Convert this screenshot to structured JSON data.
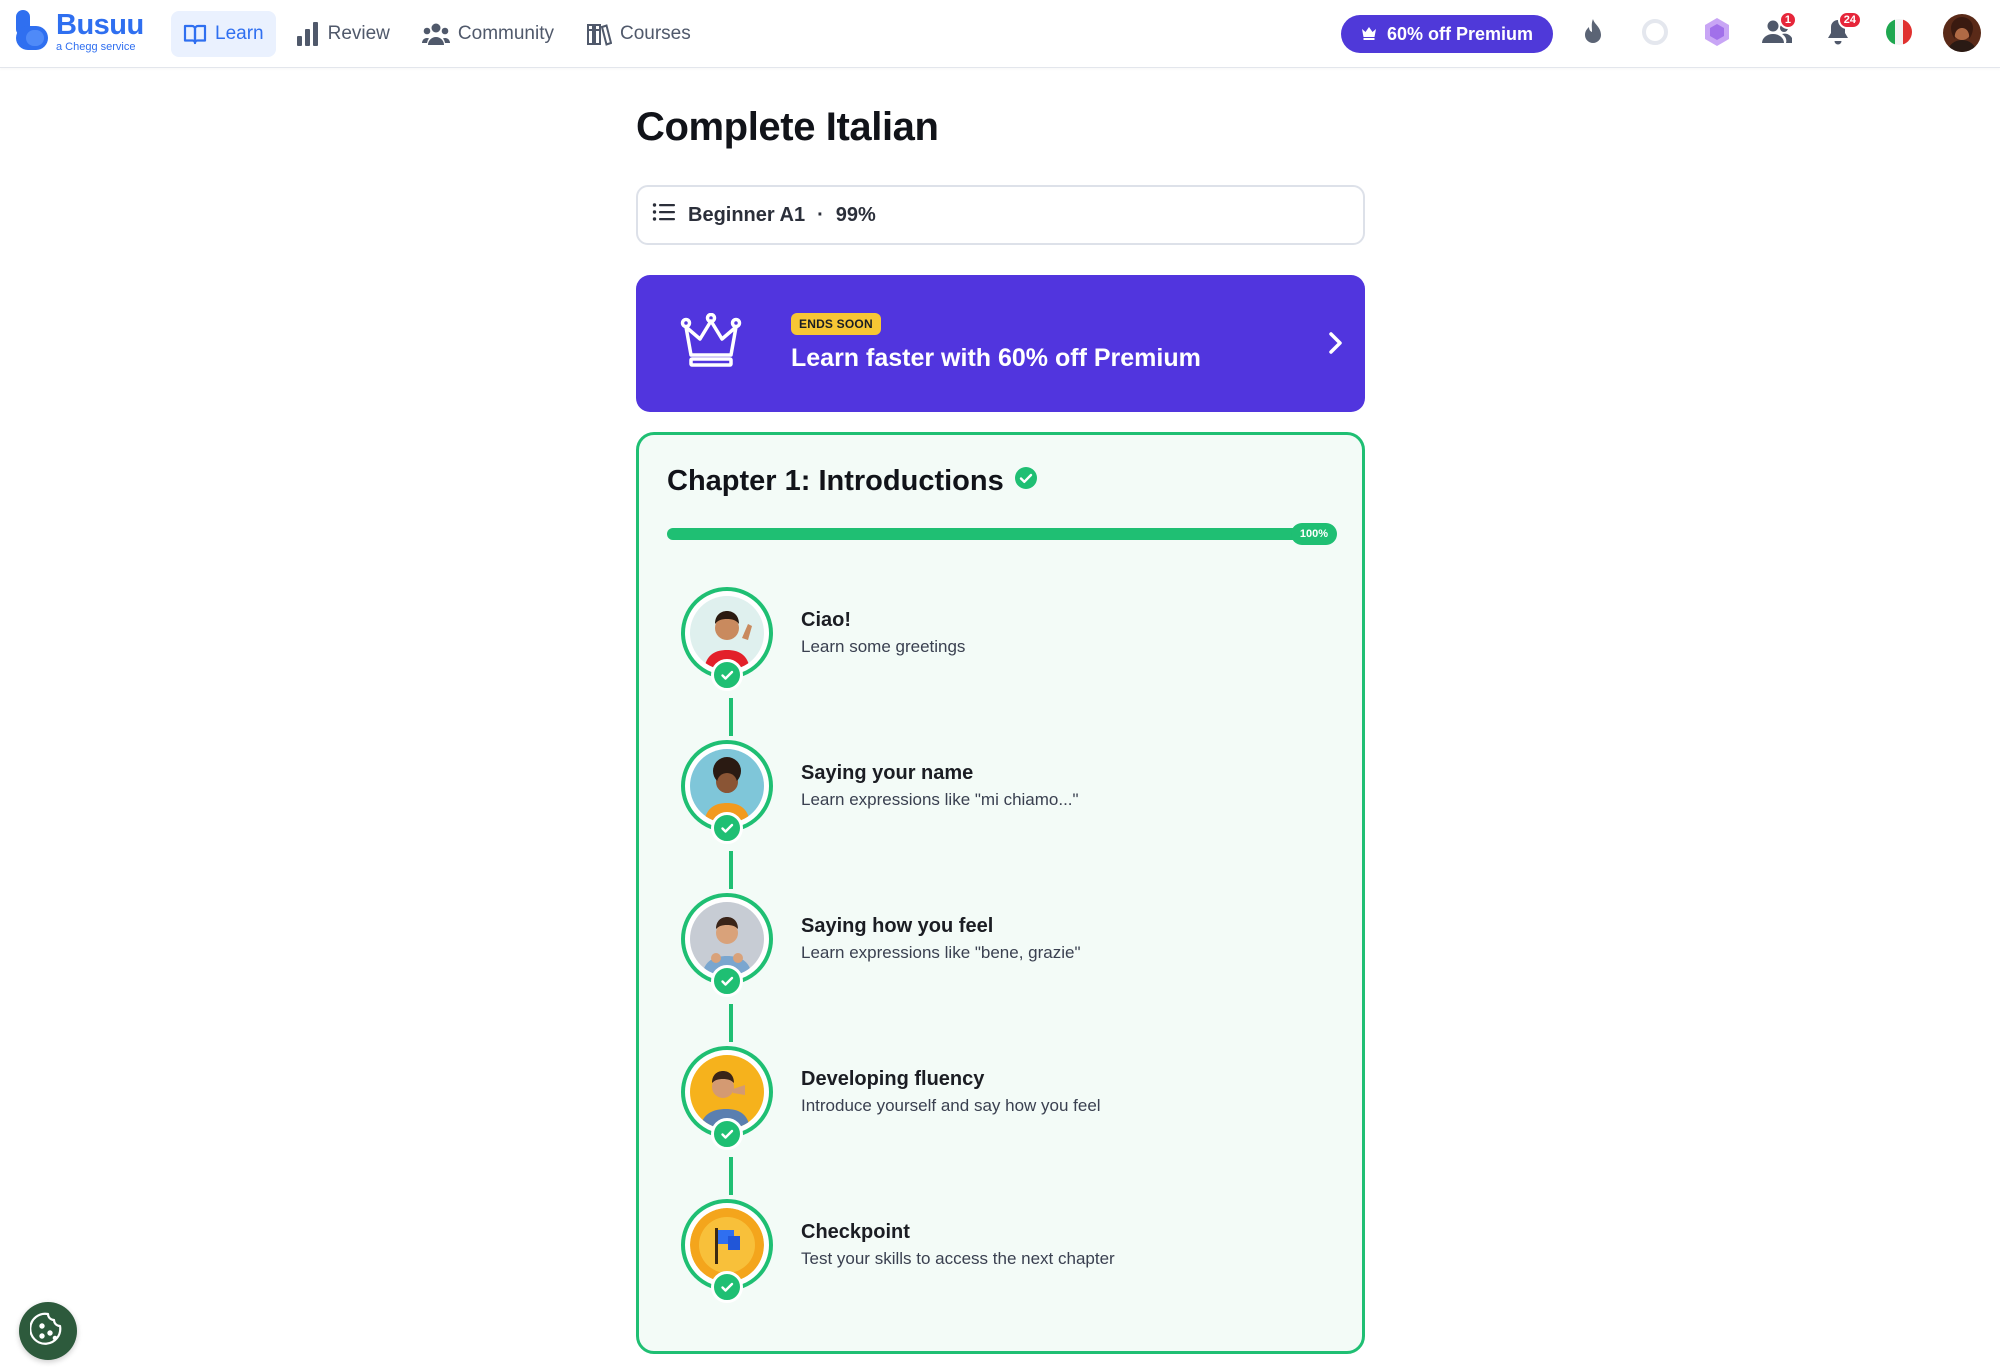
{
  "brand": {
    "name": "Busuu",
    "tagline": "a Chegg service",
    "color": "#2f6ff0"
  },
  "nav": [
    {
      "label": "Learn",
      "icon": "book-icon",
      "active": true
    },
    {
      "label": "Review",
      "icon": "bar-chart-icon",
      "active": false
    },
    {
      "label": "Community",
      "icon": "people-icon",
      "active": false
    },
    {
      "label": "Courses",
      "icon": "library-icon",
      "active": false
    }
  ],
  "header": {
    "premium_label": "60% off Premium",
    "friends_badge": "1",
    "notifications_badge": "24",
    "language": "Italian flag"
  },
  "course": {
    "title": "Complete Italian",
    "level_label": "Beginner A1",
    "level_progress": "99%"
  },
  "promo": {
    "tag": "ENDS SOON",
    "text": "Learn faster with 60% off Premium",
    "color": "#5135de"
  },
  "chapter": {
    "title": "Chapter 1: Introductions",
    "progress_label": "100%",
    "progress_value": 1.0,
    "accent": "#1fbf73",
    "lessons": [
      {
        "title": "Ciao!",
        "subtitle": "Learn some greetings",
        "completed": true
      },
      {
        "title": "Saying your name",
        "subtitle": "Learn expressions like \"mi chiamo...\"",
        "completed": true
      },
      {
        "title": "Saying how you feel",
        "subtitle": "Learn expressions like \"bene, grazie\"",
        "completed": true
      },
      {
        "title": "Developing fluency",
        "subtitle": "Introduce yourself and say how you feel",
        "completed": true
      },
      {
        "title": "Checkpoint",
        "subtitle": "Test your skills to access the next chapter",
        "completed": true
      }
    ]
  }
}
